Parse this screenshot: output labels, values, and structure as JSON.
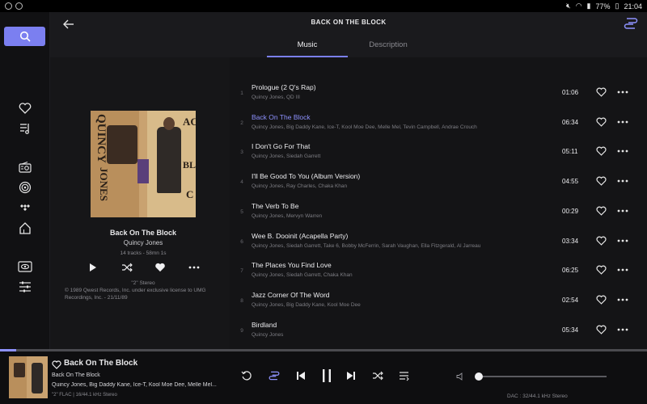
{
  "status_bar": {
    "battery": "77%",
    "time": "21:04"
  },
  "header": {
    "title": "BACK ON THE BLOCK",
    "tabs": [
      {
        "label": "Music",
        "active": true
      },
      {
        "label": "Description",
        "active": false
      }
    ]
  },
  "sidebar": {
    "icons": [
      "search-icon",
      "heart-icon",
      "playlist-icon",
      "radio-icon",
      "podcast-icon",
      "tidal-icon",
      "home-icon",
      "visualizer-icon",
      "equalizer-icon"
    ]
  },
  "album": {
    "cover_text": [
      "QUINCY",
      "JONES",
      "AC",
      "BL",
      "C"
    ],
    "title": "Back On The Block",
    "artist": "Quincy Jones",
    "meta": "14 tracks - 58mn 1s",
    "quality": "\"2\"  Stereo",
    "copyright": "© 1989 Qwest Records, Inc. under exclusive license to UMG Recordings, Inc. - 21/11/89"
  },
  "tracks": [
    {
      "num": "1",
      "title": "Prologue (2 Q's Rap)",
      "artists": "Quincy Jones, QD III",
      "duration": "01:06",
      "active": false
    },
    {
      "num": "2",
      "title": "Back On The Block",
      "artists": "Quincy Jones, Big Daddy Kane, Ice-T, Kool Moe Dee, Melle Mel, Tevin Campbell, Andrae Crouch",
      "duration": "06:34",
      "active": true
    },
    {
      "num": "3",
      "title": "I Don't Go For That",
      "artists": "Quincy Jones, Siedah Garrett",
      "duration": "05:11",
      "active": false
    },
    {
      "num": "4",
      "title": "I'll Be Good To You (Album Version)",
      "artists": "Quincy Jones, Ray Charles, Chaka Khan",
      "duration": "04:55",
      "active": false
    },
    {
      "num": "5",
      "title": "The Verb To Be",
      "artists": "Quincy Jones, Mervyn Warren",
      "duration": "00:29",
      "active": false
    },
    {
      "num": "6",
      "title": "Wee B. Dooinit (Acapella Party)",
      "artists": "Quincy Jones, Siedah Garrett, Take 6, Bobby McFerrin, Sarah Vaughan, Ella Fitzgerald, Al Jarreau",
      "duration": "03:34",
      "active": false
    },
    {
      "num": "7",
      "title": "The Places You Find Love",
      "artists": "Quincy Jones, Siedah Garrett, Chaka Khan",
      "duration": "06:25",
      "active": false
    },
    {
      "num": "8",
      "title": "Jazz Corner Of The Word",
      "artists": "Quincy Jones, Big Daddy Kane, Kool Moe Dee",
      "duration": "02:54",
      "active": false
    },
    {
      "num": "9",
      "title": "Birdland",
      "artists": "Quincy Jones",
      "duration": "05:34",
      "active": false
    }
  ],
  "player": {
    "track_title": "Back On The Block",
    "album": "Back On The Block",
    "artists": "Quincy Jones, Big Daddy Kane, Ice-T, Kool Moe Dee, Melle Mel...",
    "quality": "\"2\"  FLAC | 16/44.1 kHz Stereo",
    "dac": "DAC : 32/44.1 kHz Stereo",
    "progress_fraction": 0.025,
    "volume_fraction": 0.0
  },
  "colors": {
    "accent": "#7b7ff0",
    "active_track": "#8e92ff",
    "background": "#141416"
  }
}
